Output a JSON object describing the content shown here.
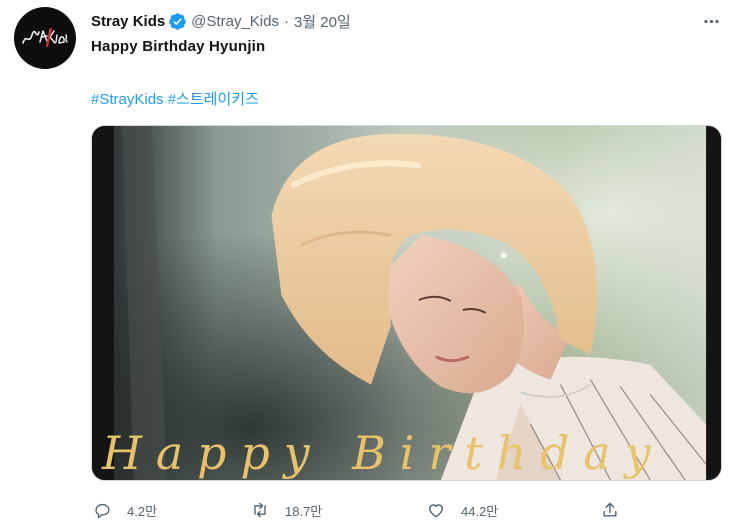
{
  "tweet": {
    "display_name": "Stray Kids",
    "handle": "@Stray_Kids",
    "separator": "·",
    "timestamp": "3월 20일",
    "text": "Happy Birthday Hyunjin",
    "hashtags": [
      "#StrayKids",
      "#스트레이키즈"
    ],
    "avatar_logo_text": "Stray Kids",
    "image_caption": "Happy Birthday",
    "icons": [
      "verified-badge-icon",
      "more-icon",
      "reply-icon",
      "retweet-icon",
      "like-icon",
      "share-icon"
    ],
    "colors": {
      "link": "#1d9bf0",
      "verified": "#1d9bf0",
      "secondary": "#536471",
      "caption": "#e8c26a"
    }
  },
  "actions": {
    "reply_count": "4.2만",
    "retweet_count": "18.7만",
    "like_count": "44.2만"
  }
}
